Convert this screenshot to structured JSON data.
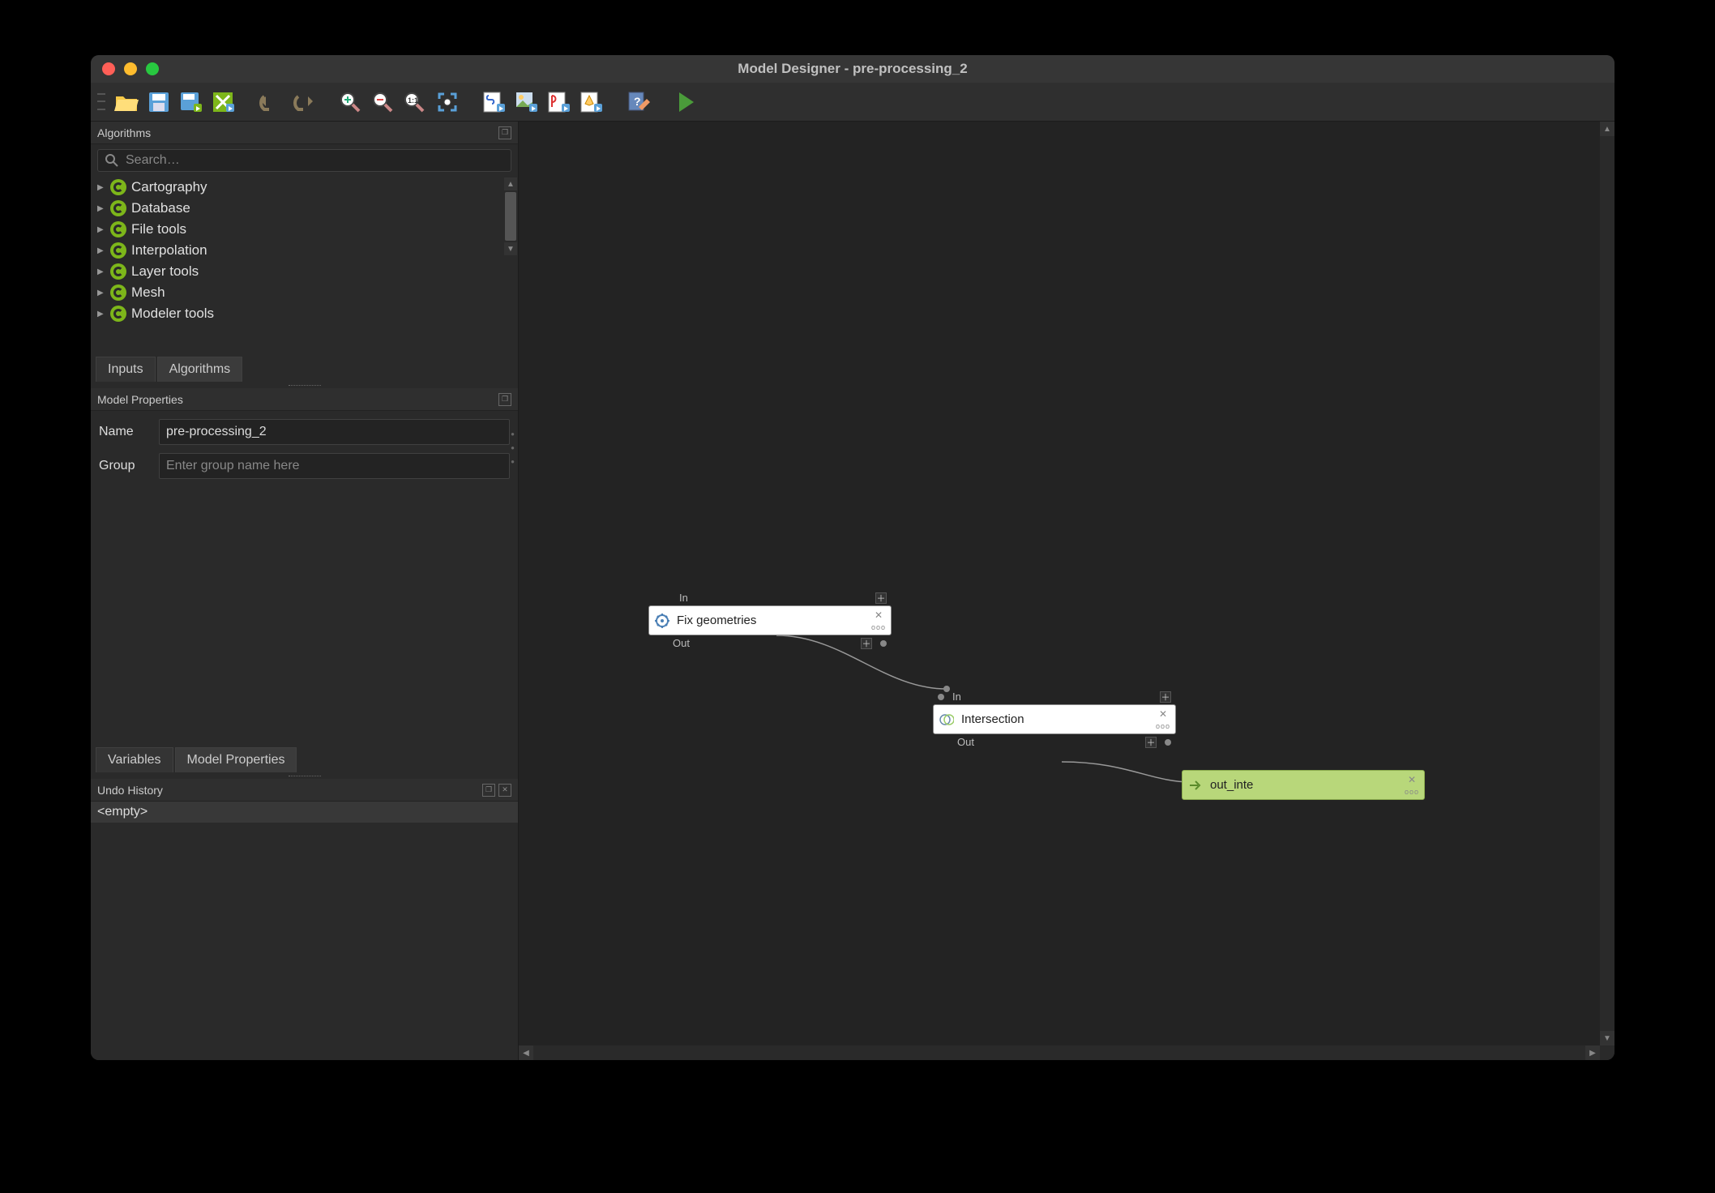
{
  "title": "Model Designer - pre-processing_2",
  "toolbar": {
    "buttons": [
      "open-model",
      "save-model",
      "save-as",
      "validate",
      "undo",
      "redo",
      "zoom-in",
      "zoom-out",
      "zoom-actual",
      "zoom-full",
      "export-python",
      "export-image",
      "export-pdf",
      "export-svg",
      "help",
      "run"
    ]
  },
  "algorithms": {
    "title": "Algorithms",
    "search_placeholder": "Search…",
    "items": [
      {
        "label": "Cartography"
      },
      {
        "label": "Database"
      },
      {
        "label": "File tools"
      },
      {
        "label": "Interpolation"
      },
      {
        "label": "Layer tools"
      },
      {
        "label": "Mesh"
      },
      {
        "label": "Modeler tools"
      }
    ],
    "tabs": {
      "inputs": "Inputs",
      "algorithms": "Algorithms"
    }
  },
  "model_properties": {
    "title": "Model Properties",
    "name_label": "Name",
    "name_value": "pre-processing_2",
    "group_label": "Group",
    "group_placeholder": "Enter group name here",
    "tabs": {
      "variables": "Variables",
      "model_properties": "Model Properties"
    }
  },
  "undo": {
    "title": "Undo History",
    "items": [
      "<empty>"
    ]
  },
  "nodes": {
    "n1": {
      "title": "Fix geometries",
      "in": "In",
      "out": "Out"
    },
    "n2": {
      "title": "Intersection",
      "in": "In",
      "out": "Out"
    },
    "n3": {
      "title": "out_inte"
    }
  }
}
